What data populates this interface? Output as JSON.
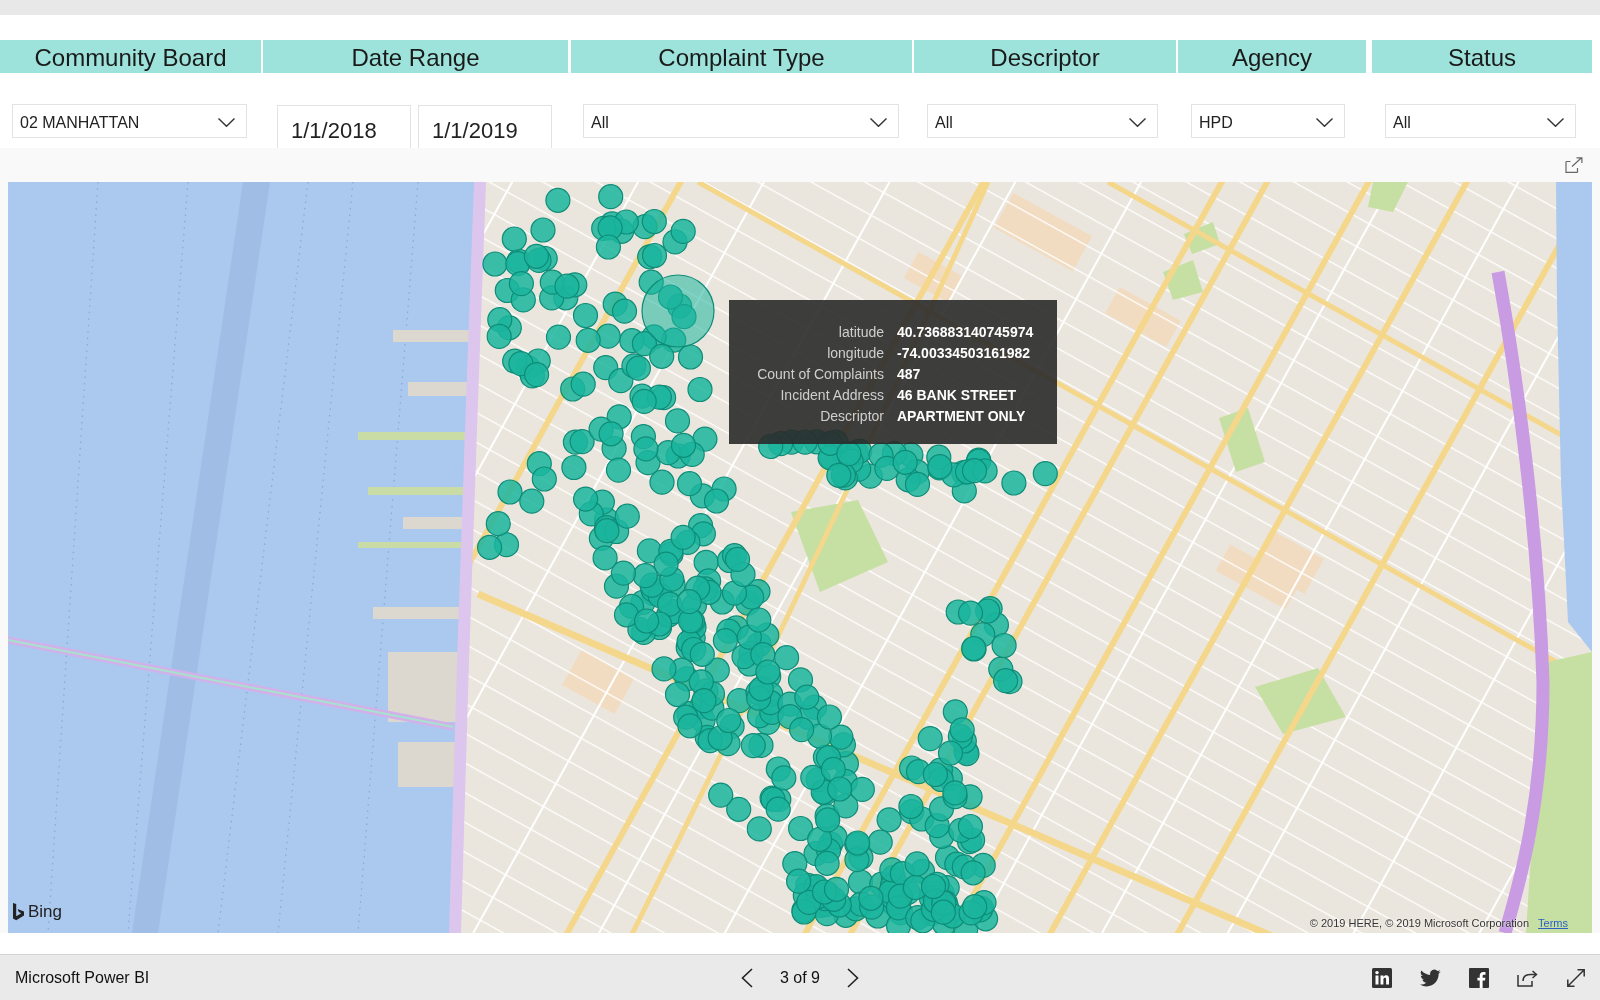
{
  "filters": [
    {
      "kind": "dropdown",
      "header": "Community Board",
      "value": "02 MANHATTAN"
    },
    {
      "kind": "date_range",
      "header": "Date Range",
      "values": [
        "1/1/2018",
        "1/1/2019"
      ]
    },
    {
      "kind": "dropdown",
      "header": "Complaint Type",
      "value": "All"
    },
    {
      "kind": "dropdown",
      "header": "Descriptor",
      "value": "All"
    },
    {
      "kind": "dropdown",
      "header": "Agency",
      "value": "HPD"
    },
    {
      "kind": "dropdown",
      "header": "Status",
      "value": "All"
    }
  ],
  "map": {
    "tooltip": [
      {
        "label": "latitude",
        "value": "40.736883140745974"
      },
      {
        "label": "longitude",
        "value": "-74.00334503161982"
      },
      {
        "label": "Count of Complaints",
        "value": "487"
      },
      {
        "label": "Incident Address",
        "value": "46 BANK STREET"
      },
      {
        "label": "Descriptor",
        "value": "APARTMENT ONLY"
      }
    ],
    "logo": "Bing",
    "attribution": "© 2019 HERE, © 2019 Microsoft Corporation",
    "terms_link": "Terms"
  },
  "footer": {
    "brand": "Microsoft Power BI",
    "page_indicator": "3 of 9"
  }
}
